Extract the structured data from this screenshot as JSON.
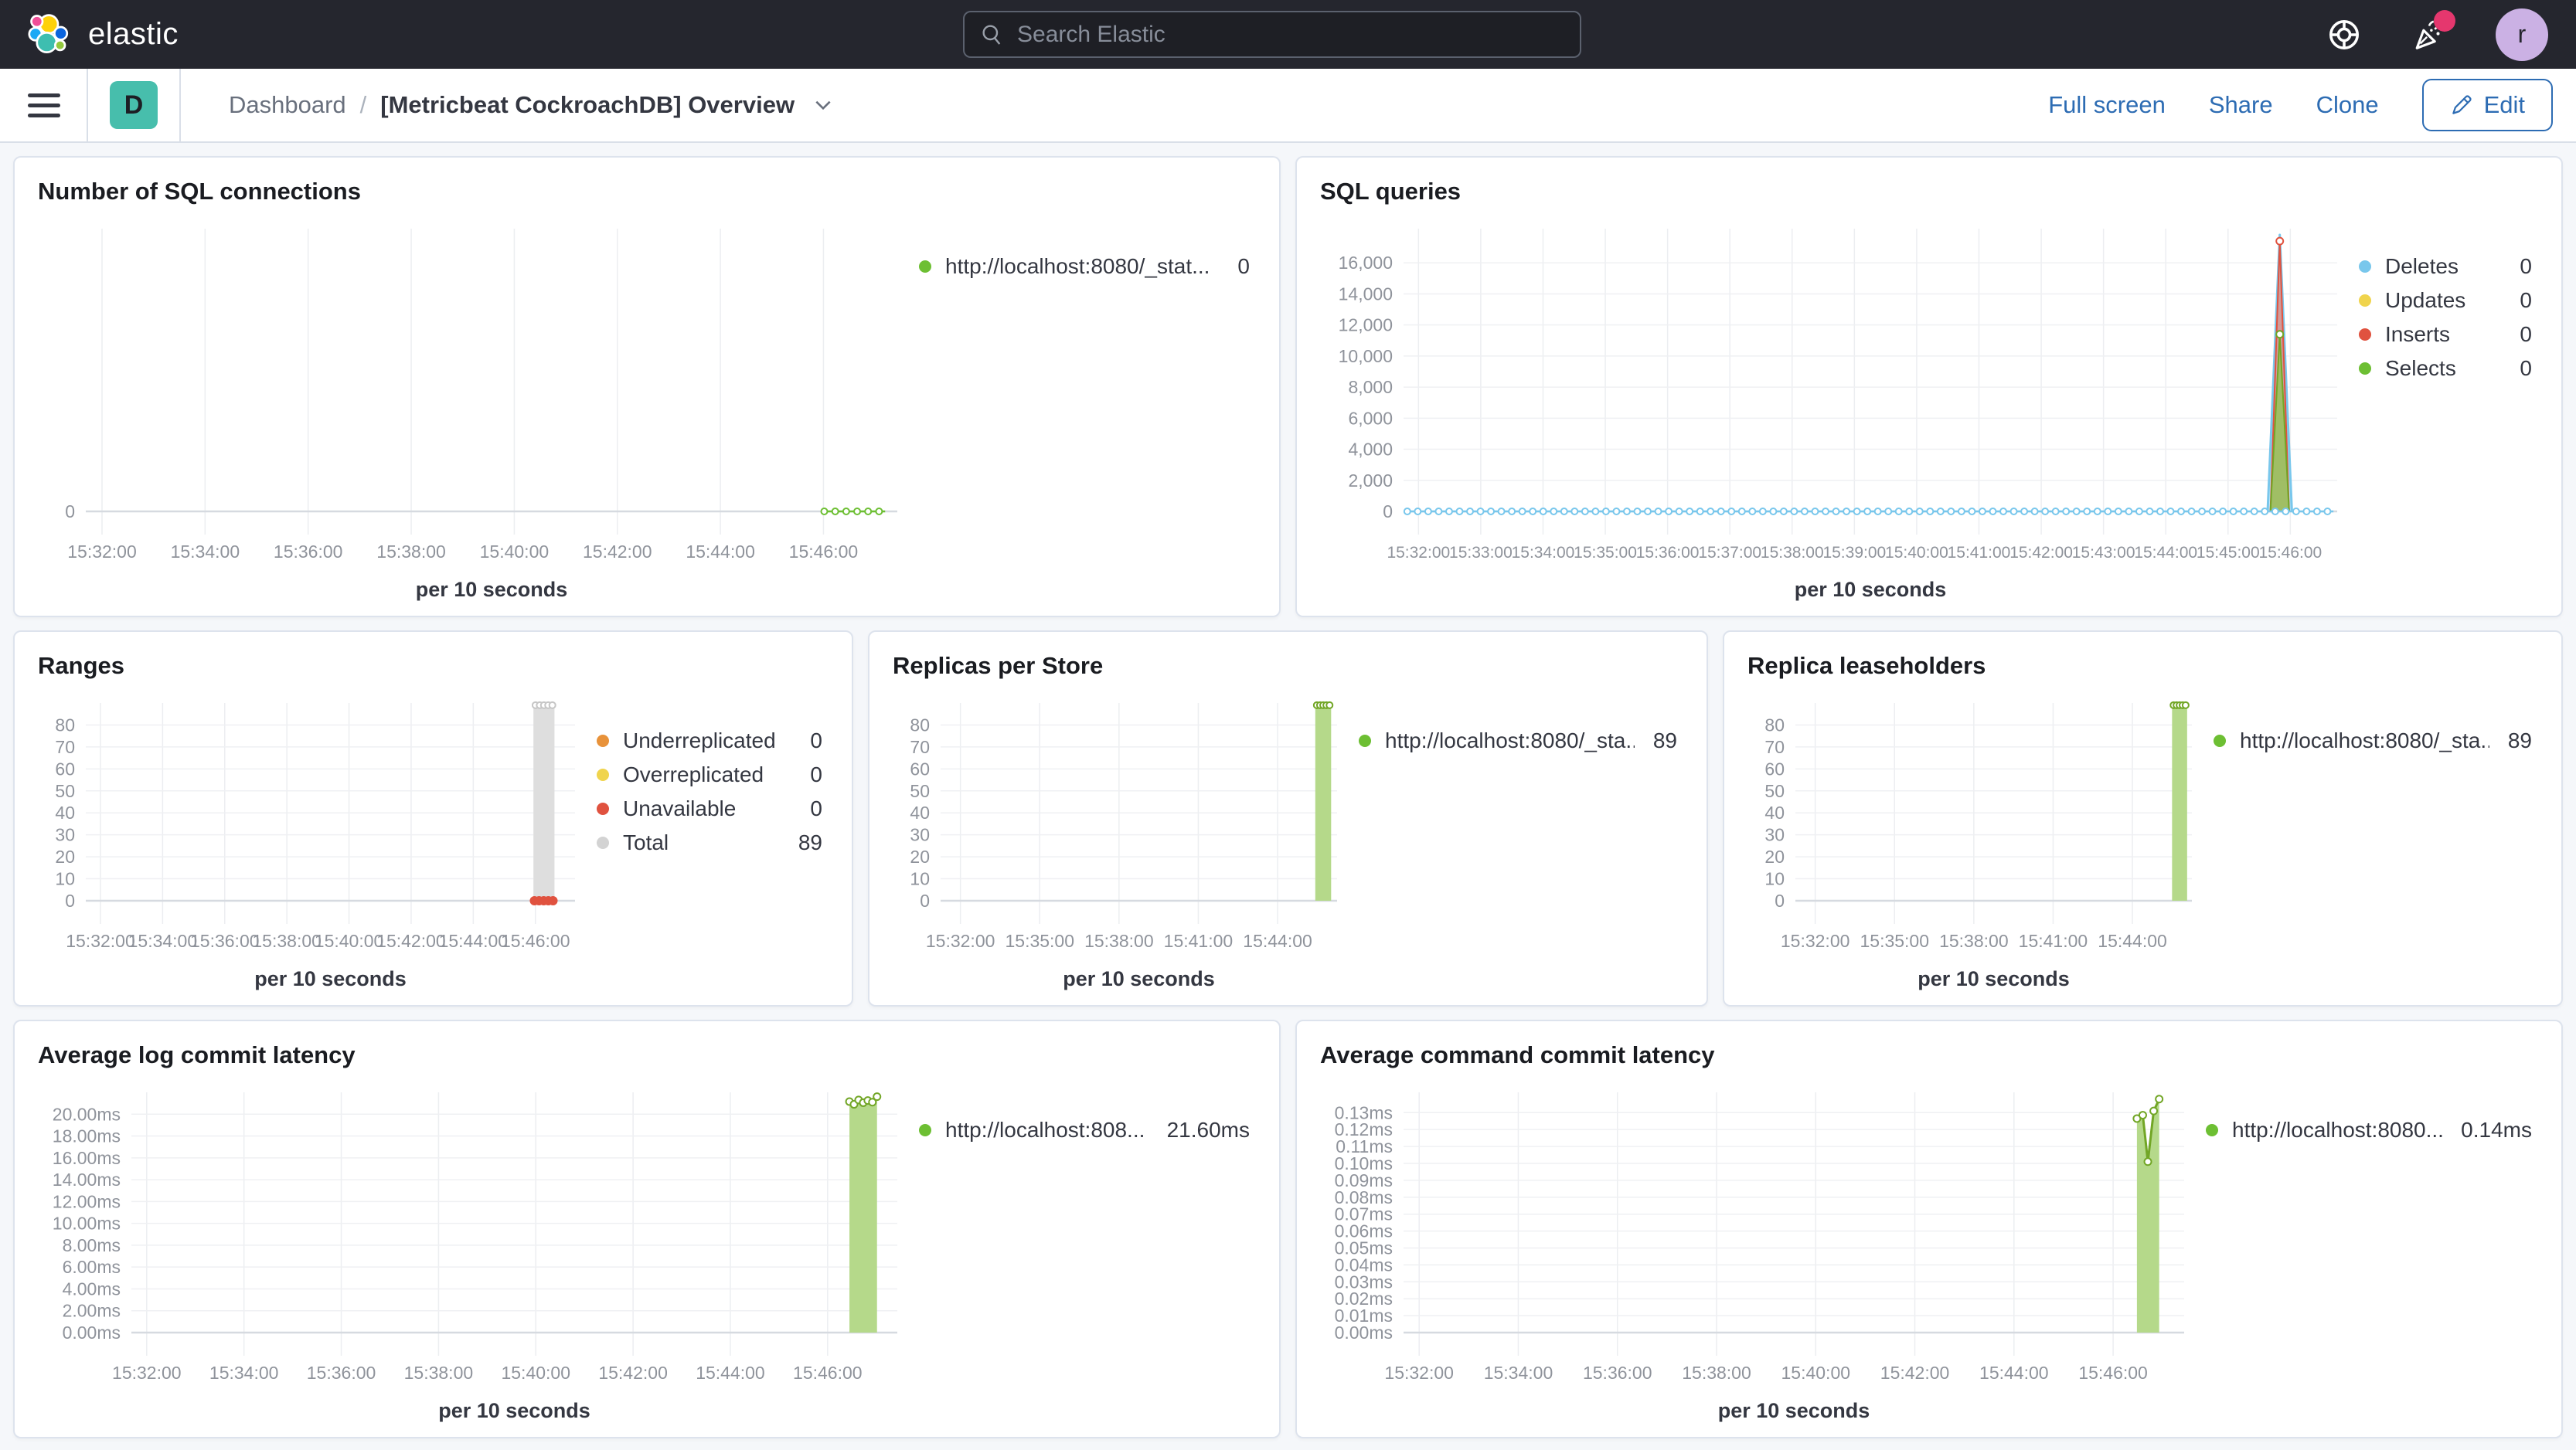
{
  "topbar": {
    "brand": "elastic",
    "search_placeholder": "Search Elastic",
    "avatar_initial": "r",
    "notification_color": "#E5376E"
  },
  "header": {
    "breadcrumb_root": "Dashboard",
    "breadcrumb_sep": "/",
    "title": "[Metricbeat CockroachDB] Overview",
    "actions": [
      "Full screen",
      "Share",
      "Clone"
    ],
    "edit_label": "Edit"
  },
  "colors": {
    "green": "#6DBF33",
    "light_green_fill": "#B5D98A",
    "green_stroke": "#72A626",
    "blue": "#79C7EC",
    "yellow": "#F0D44D",
    "red": "#E0523F",
    "orange": "#E8923A",
    "gray": "#D3D3D3",
    "link_blue": "#2D6CB3",
    "badge_teal": "#47BEAC"
  },
  "charts": {
    "sql_connections": {
      "type": "line",
      "title": "Number of SQL connections",
      "xlabel": "per 10 seconds",
      "ymax": 1,
      "y_ticks": [
        {
          "v": 0,
          "label": "0"
        }
      ],
      "x_ticks": {
        "start": 0.02,
        "step": 0.127,
        "labels": [
          "15:32:00",
          "15:34:00",
          "15:36:00",
          "15:38:00",
          "15:40:00",
          "15:42:00",
          "15:44:00",
          "15:46:00"
        ]
      },
      "shapes": [
        {
          "kind": "hmarkers",
          "y": 0,
          "x0": 0.91,
          "x1": 0.985,
          "step": 0.0135,
          "color": "#6DBF33",
          "r": 4,
          "open": true,
          "line": true
        }
      ],
      "legend": [
        {
          "color": "#6DBF33",
          "label": "http://localhost:8080/_stat...",
          "value": "0"
        }
      ]
    },
    "sql_queries": {
      "type": "line",
      "title": "SQL queries",
      "xlabel": "per 10 seconds",
      "ymax": 18200,
      "y_ticks": [
        {
          "v": 0,
          "label": "0"
        },
        {
          "v": 2000,
          "label": "2,000"
        },
        {
          "v": 4000,
          "label": "4,000"
        },
        {
          "v": 6000,
          "label": "6,000"
        },
        {
          "v": 8000,
          "label": "8,000"
        },
        {
          "v": 10000,
          "label": "10,000"
        },
        {
          "v": 12000,
          "label": "12,000"
        },
        {
          "v": 14000,
          "label": "14,000"
        },
        {
          "v": 16000,
          "label": "16,000"
        }
      ],
      "x_ticks": {
        "start": 0.016,
        "step": 0.0667,
        "font": 21,
        "labels": [
          "15:32:00",
          "15:33:00",
          "15:34:00",
          "15:35:00",
          "15:36:00",
          "15:37:00",
          "15:38:00",
          "15:39:00",
          "15:40:00",
          "15:41:00",
          "15:42:00",
          "15:43:00",
          "15:44:00",
          "15:45:00",
          "15:46:00"
        ]
      },
      "shapes": [
        {
          "kind": "area",
          "points": [
            [
              0.9255,
              0
            ],
            [
              0.9385,
              17800
            ],
            [
              0.9515,
              0
            ]
          ],
          "fill": "rgba(121,199,236,0.45)",
          "stroke": "#79C7EC",
          "sw": 3
        },
        {
          "kind": "area",
          "points": [
            [
              0.9285,
              0
            ],
            [
              0.9385,
              17400
            ],
            [
              0.9485,
              0
            ]
          ],
          "fill": "rgba(224,82,63,0.50)",
          "stroke": "#E0523F",
          "sw": 2,
          "markers": [
            [
              0.9385,
              17400
            ]
          ]
        },
        {
          "kind": "area",
          "points": [
            [
              0.9285,
              0
            ],
            [
              0.9385,
              11400
            ],
            [
              0.9485,
              0
            ]
          ],
          "fill": "rgba(148,199,88,0.80)",
          "stroke": "#72A626",
          "sw": 2,
          "markers": [
            [
              0.9385,
              11400
            ]
          ]
        },
        {
          "kind": "hmarkers",
          "y": 0,
          "x0": 0.004,
          "x1": 0.996,
          "step": 0.0112,
          "color": "#79C7EC",
          "r": 4,
          "open": true,
          "line": true
        }
      ],
      "legend": [
        {
          "color": "#79C7EC",
          "label": "Deletes",
          "value": "0"
        },
        {
          "color": "#F0D44D",
          "label": "Updates",
          "value": "0"
        },
        {
          "color": "#E0523F",
          "label": "Inserts",
          "value": "0"
        },
        {
          "color": "#6DBF33",
          "label": "Selects",
          "value": "0"
        }
      ],
      "peaks": {
        "deletes": 17800,
        "inserts": 17400,
        "selects": 11400,
        "updates": 0,
        "peak_time": "15:45:50"
      }
    },
    "ranges": {
      "type": "bar",
      "title": "Ranges",
      "xlabel": "per 10 seconds",
      "ymax": 90,
      "y_ticks": [
        {
          "v": 0,
          "label": "0"
        },
        {
          "v": 10,
          "label": "10"
        },
        {
          "v": 20,
          "label": "20"
        },
        {
          "v": 30,
          "label": "30"
        },
        {
          "v": 40,
          "label": "40"
        },
        {
          "v": 50,
          "label": "50"
        },
        {
          "v": 60,
          "label": "60"
        },
        {
          "v": 70,
          "label": "70"
        },
        {
          "v": 80,
          "label": "80"
        }
      ],
      "x_ticks": {
        "start": 0.03,
        "step": 0.127,
        "labels": [
          "15:32:00",
          "15:34:00",
          "15:36:00",
          "15:38:00",
          "15:40:00",
          "15:42:00",
          "15:44:00",
          "15:46:00"
        ]
      },
      "shapes": [
        {
          "kind": "bar",
          "x0": 0.915,
          "x1": 0.958,
          "y": 89,
          "fill": "#DEDEDE",
          "top_marker": "#C6C6C6"
        },
        {
          "kind": "hmarkers",
          "y": 0,
          "x0": 0.917,
          "x1": 0.956,
          "step": 0.0095,
          "color": "#E0523F",
          "r": 5,
          "open": false,
          "line": false
        }
      ],
      "legend": [
        {
          "color": "#E8923A",
          "label": "Underreplicated",
          "value": "0"
        },
        {
          "color": "#F0D44D",
          "label": "Overreplicated",
          "value": "0"
        },
        {
          "color": "#E0523F",
          "label": "Unavailable",
          "value": "0"
        },
        {
          "color": "#D3D3D3",
          "label": "Total",
          "value": "89"
        }
      ]
    },
    "replicas": {
      "type": "bar",
      "title": "Replicas per Store",
      "xlabel": "per 10 seconds",
      "ymax": 90,
      "y_ticks": [
        {
          "v": 0,
          "label": "0"
        },
        {
          "v": 10,
          "label": "10"
        },
        {
          "v": 20,
          "label": "20"
        },
        {
          "v": 30,
          "label": "30"
        },
        {
          "v": 40,
          "label": "40"
        },
        {
          "v": 50,
          "label": "50"
        },
        {
          "v": 60,
          "label": "60"
        },
        {
          "v": 70,
          "label": "70"
        },
        {
          "v": 80,
          "label": "80"
        }
      ],
      "x_ticks": {
        "start": 0.05,
        "step": 0.2,
        "labels": [
          "15:32:00",
          "15:35:00",
          "15:38:00",
          "15:41:00",
          "15:44:00"
        ]
      },
      "shapes": [
        {
          "kind": "bar",
          "x0": 0.945,
          "x1": 0.985,
          "y": 89,
          "fill": "#B5D98A",
          "top_marker": "#72A626"
        }
      ],
      "legend": [
        {
          "color": "#6DBF33",
          "label": "http://localhost:8080/_sta...",
          "value": "89"
        }
      ]
    },
    "leaseholders": {
      "type": "bar",
      "title": "Replica leaseholders",
      "xlabel": "per 10 seconds",
      "ymax": 90,
      "y_ticks": [
        {
          "v": 0,
          "label": "0"
        },
        {
          "v": 10,
          "label": "10"
        },
        {
          "v": 20,
          "label": "20"
        },
        {
          "v": 30,
          "label": "30"
        },
        {
          "v": 40,
          "label": "40"
        },
        {
          "v": 50,
          "label": "50"
        },
        {
          "v": 60,
          "label": "60"
        },
        {
          "v": 70,
          "label": "70"
        },
        {
          "v": 80,
          "label": "80"
        }
      ],
      "x_ticks": {
        "start": 0.05,
        "step": 0.2,
        "labels": [
          "15:32:00",
          "15:35:00",
          "15:38:00",
          "15:41:00",
          "15:44:00"
        ]
      },
      "shapes": [
        {
          "kind": "bar",
          "x0": 0.95,
          "x1": 0.988,
          "y": 89,
          "fill": "#B5D98A",
          "top_marker": "#72A626"
        }
      ],
      "legend": [
        {
          "color": "#6DBF33",
          "label": "http://localhost:8080/_sta...",
          "value": "89"
        }
      ]
    },
    "log_latency": {
      "type": "area",
      "title": "Average log commit latency",
      "xlabel": "per 10 seconds",
      "ymax": 22,
      "y_ticks": [
        {
          "v": 0,
          "label": "0.00ms"
        },
        {
          "v": 2,
          "label": "2.00ms"
        },
        {
          "v": 4,
          "label": "4.00ms"
        },
        {
          "v": 6,
          "label": "6.00ms"
        },
        {
          "v": 8,
          "label": "8.00ms"
        },
        {
          "v": 10,
          "label": "10.00ms"
        },
        {
          "v": 12,
          "label": "12.00ms"
        },
        {
          "v": 14,
          "label": "14.00ms"
        },
        {
          "v": 16,
          "label": "16.00ms"
        },
        {
          "v": 18,
          "label": "18.00ms"
        },
        {
          "v": 20,
          "label": "20.00ms"
        }
      ],
      "x_ticks": {
        "start": 0.02,
        "step": 0.127,
        "labels": [
          "15:32:00",
          "15:34:00",
          "15:36:00",
          "15:38:00",
          "15:40:00",
          "15:42:00",
          "15:44:00",
          "15:46:00"
        ]
      },
      "shapes": [
        {
          "kind": "area",
          "close": true,
          "markers": "all",
          "sw": 3,
          "points": [
            [
              0.9375,
              21.15
            ],
            [
              0.9435,
              20.9
            ],
            [
              0.9495,
              21.3
            ],
            [
              0.9555,
              21.05
            ],
            [
              0.9615,
              21.25
            ],
            [
              0.9675,
              21.1
            ],
            [
              0.9735,
              21.6
            ]
          ],
          "fill": "#B5D98A",
          "stroke": "#72A626"
        }
      ],
      "legend": [
        {
          "color": "#6DBF33",
          "label": "http://localhost:808...",
          "value": "21.60ms"
        }
      ]
    },
    "cmd_latency": {
      "type": "area",
      "title": "Average command commit latency",
      "xlabel": "per 10 seconds",
      "ymax": 0.142,
      "y_ticks": [
        {
          "v": 0,
          "label": "0.00ms"
        },
        {
          "v": 0.01,
          "label": "0.01ms"
        },
        {
          "v": 0.02,
          "label": "0.02ms"
        },
        {
          "v": 0.03,
          "label": "0.03ms"
        },
        {
          "v": 0.04,
          "label": "0.04ms"
        },
        {
          "v": 0.05,
          "label": "0.05ms"
        },
        {
          "v": 0.06,
          "label": "0.06ms"
        },
        {
          "v": 0.07,
          "label": "0.07ms"
        },
        {
          "v": 0.08,
          "label": "0.08ms"
        },
        {
          "v": 0.09,
          "label": "0.09ms"
        },
        {
          "v": 0.1,
          "label": "0.10ms"
        },
        {
          "v": 0.11,
          "label": "0.11ms"
        },
        {
          "v": 0.12,
          "label": "0.12ms"
        },
        {
          "v": 0.13,
          "label": "0.13ms"
        }
      ],
      "x_ticks": {
        "start": 0.02,
        "step": 0.127,
        "labels": [
          "15:32:00",
          "15:34:00",
          "15:36:00",
          "15:38:00",
          "15:40:00",
          "15:42:00",
          "15:44:00",
          "15:46:00"
        ]
      },
      "shapes": [
        {
          "kind": "area",
          "close": true,
          "markers": "all",
          "sw": 3,
          "points": [
            [
              0.9395,
              0.1265
            ],
            [
              0.947,
              0.1285
            ],
            [
              0.9535,
              0.101
            ],
            [
              0.961,
              0.131
            ],
            [
              0.968,
              0.138
            ]
          ],
          "fill": "#B5D98A",
          "stroke": "#72A626"
        }
      ],
      "legend": [
        {
          "color": "#6DBF33",
          "label": "http://localhost:8080...",
          "value": "0.14ms"
        }
      ]
    }
  }
}
